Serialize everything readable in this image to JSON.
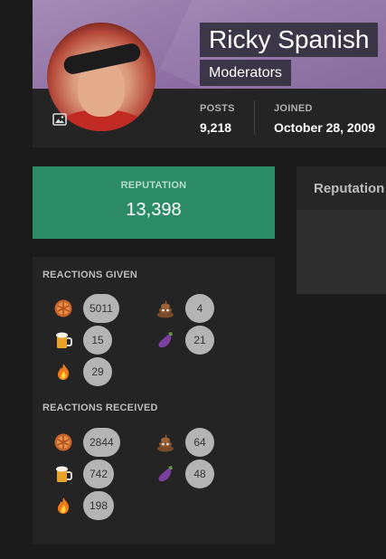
{
  "profile": {
    "username": "Ricky Spanish",
    "usergroup": "Moderators",
    "stats": {
      "posts_label": "POSTS",
      "posts_value": "9,218",
      "joined_label": "JOINED",
      "joined_value": "October 28, 2009"
    }
  },
  "reputation": {
    "label": "REPUTATION",
    "value": "13,398"
  },
  "side_panel": {
    "title": "Reputation"
  },
  "reactions": {
    "given_title": "REACTIONS GIVEN",
    "received_title": "REACTIONS RECEIVED",
    "given": [
      {
        "icon": "pie-icon",
        "count": "5011"
      },
      {
        "icon": "poop-icon",
        "count": "4"
      },
      {
        "icon": "beer-icon",
        "count": "15"
      },
      {
        "icon": "eggplant-icon",
        "count": "21"
      },
      {
        "icon": "fire-icon",
        "count": "29"
      }
    ],
    "received": [
      {
        "icon": "pie-icon",
        "count": "2844"
      },
      {
        "icon": "poop-icon",
        "count": "64"
      },
      {
        "icon": "beer-icon",
        "count": "742"
      },
      {
        "icon": "eggplant-icon",
        "count": "48"
      },
      {
        "icon": "fire-icon",
        "count": "198"
      }
    ]
  },
  "colors": {
    "background": "#1b1b1b",
    "card": "#242424",
    "cover": "#a58bb6",
    "reputation_green": "#2d8c68",
    "count_badge": "#b4b4b4"
  }
}
